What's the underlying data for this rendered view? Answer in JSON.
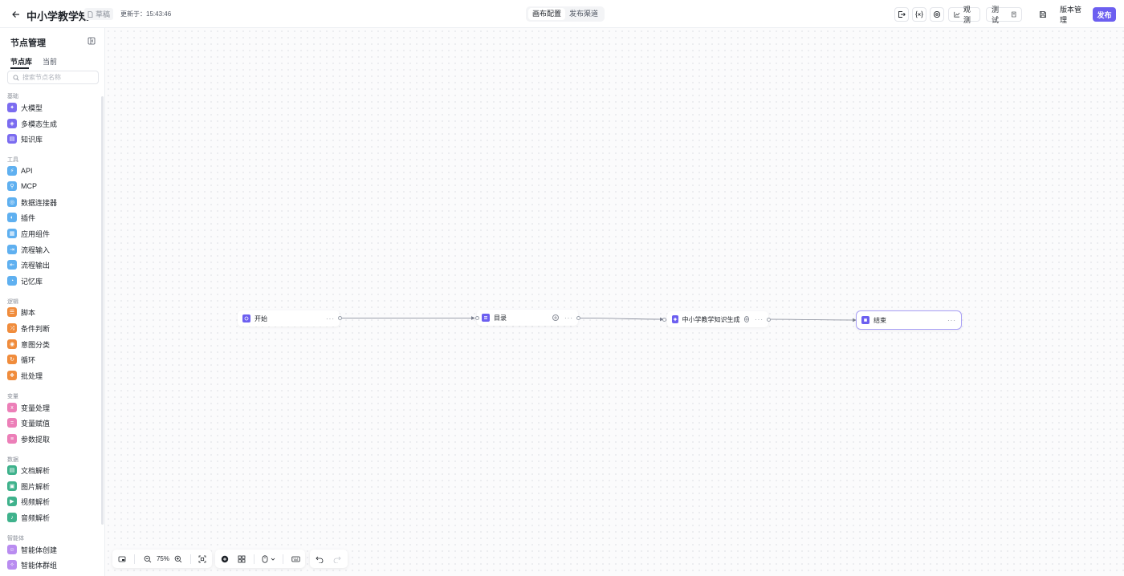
{
  "header": {
    "title": "中小学教学知...",
    "draft": "草稿",
    "updated": "更新于：15:43:46",
    "tabs": [
      "画布配置",
      "发布渠道"
    ],
    "observe": "观测",
    "test": "测试",
    "version": "版本管理",
    "publish": "发布"
  },
  "sidebar": {
    "title": "节点管理",
    "tabs": [
      "节点库",
      "当前"
    ],
    "search_placeholder": "搜索节点名称",
    "groups": [
      {
        "title": "基础",
        "items": [
          {
            "label": "大模型",
            "color": "#7b6cf0"
          },
          {
            "label": "多模态生成",
            "color": "#7b6cf0"
          },
          {
            "label": "知识库",
            "color": "#7b6cf0"
          }
        ]
      },
      {
        "title": "工具",
        "items": [
          {
            "label": "API",
            "color": "#5fb0f0"
          },
          {
            "label": "MCP",
            "color": "#5fb0f0"
          },
          {
            "label": "数据连接器",
            "color": "#5fb0f0"
          },
          {
            "label": "插件",
            "color": "#5fb0f0"
          },
          {
            "label": "应用组件",
            "color": "#5fb0f0"
          },
          {
            "label": "流程输入",
            "color": "#5fb0f0"
          },
          {
            "label": "流程输出",
            "color": "#5fb0f0"
          },
          {
            "label": "记忆库",
            "color": "#5fb0f0"
          }
        ]
      },
      {
        "title": "逻辑",
        "items": [
          {
            "label": "脚本",
            "color": "#f08c3c"
          },
          {
            "label": "条件判断",
            "color": "#f08c3c"
          },
          {
            "label": "意图分类",
            "color": "#f08c3c"
          },
          {
            "label": "循环",
            "color": "#f08c3c"
          },
          {
            "label": "批处理",
            "color": "#f08c3c"
          }
        ]
      },
      {
        "title": "变量",
        "items": [
          {
            "label": "变量处理",
            "color": "#ec7fb8"
          },
          {
            "label": "变量赋值",
            "color": "#ec7fb8"
          },
          {
            "label": "参数提取",
            "color": "#ec7fb8"
          }
        ]
      },
      {
        "title": "数据",
        "items": [
          {
            "label": "文档解析",
            "color": "#3fb28c"
          },
          {
            "label": "图片解析",
            "color": "#3fb28c"
          },
          {
            "label": "视频解析",
            "color": "#3fb28c"
          },
          {
            "label": "音频解析",
            "color": "#3fb28c"
          }
        ]
      },
      {
        "title": "智能体",
        "items": [
          {
            "label": "智能体创建",
            "color": "#b98cf0"
          },
          {
            "label": "智能体群组",
            "color": "#b98cf0"
          }
        ]
      }
    ]
  },
  "canvas": {
    "nodes": [
      {
        "label": "开始"
      },
      {
        "label": "目录"
      },
      {
        "label": "中小学教学知识生成"
      },
      {
        "label": "结束"
      }
    ],
    "more_glyph": "···"
  },
  "toolbar": {
    "zoom": "75%"
  },
  "colors": {
    "accent": "#6c5ff0"
  }
}
